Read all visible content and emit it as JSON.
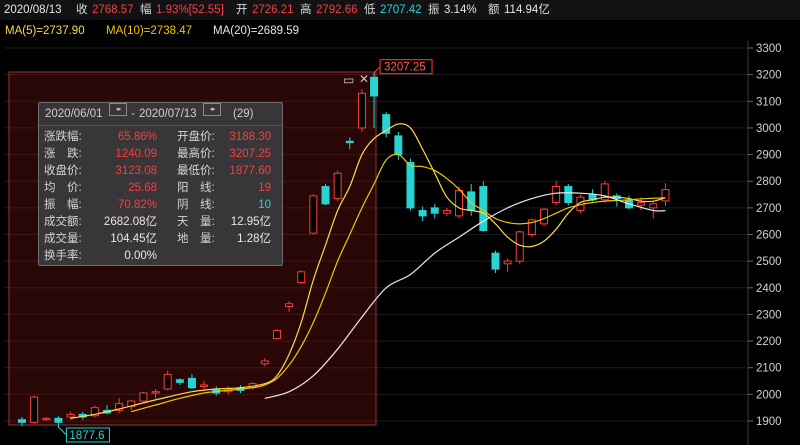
{
  "topbar": {
    "date": "2020/08/13",
    "close_label": "收",
    "close_value": "2768.57",
    "change_label": "幅",
    "change_value": "1.93%[52.55]",
    "open_label": "开",
    "open_value": "2726.21",
    "high_label": "高",
    "high_value": "2792.66",
    "low_label": "低",
    "low_value": "2707.42",
    "amp_label": "振",
    "amp_value": "3.14%",
    "amount_label": "额",
    "amount_value": "114.94亿"
  },
  "ma_bar": {
    "ma5": "MA(5)=2737.90",
    "ma10": "MA(10)=2738.47",
    "ma20": "MA(20)=2689.59"
  },
  "colors": {
    "background": "#000000",
    "up": "#ff3b3b",
    "down": "#27d3d3",
    "ma5": "#ffffff",
    "ma10": "#f5d020",
    "ma20": "#ffffff",
    "selection": "#7a2a2a"
  },
  "chart_data": {
    "type": "candlestick",
    "ylim": [
      1850,
      3330
    ],
    "y_ticks": [
      "1900",
      "2000",
      "2100",
      "2200",
      "2300",
      "2400",
      "2500",
      "2600",
      "2700",
      "2800",
      "2900",
      "3000",
      "3100",
      "3200",
      "3300"
    ],
    "markers": {
      "high_label": "3207.25",
      "low_label": "1877.6"
    },
    "candles": [
      {
        "o": 1905,
        "c": 1895,
        "h": 1915,
        "l": 1880
      },
      {
        "o": 1895,
        "c": 1990,
        "h": 1995,
        "l": 1890
      },
      {
        "o": 1905,
        "c": 1910,
        "h": 1915,
        "l": 1900
      },
      {
        "o": 1910,
        "c": 1895,
        "h": 1918,
        "l": 1877.6
      },
      {
        "o": 1915,
        "c": 1925,
        "h": 1935,
        "l": 1905
      },
      {
        "o": 1925,
        "c": 1915,
        "h": 1935,
        "l": 1905
      },
      {
        "o": 1920,
        "c": 1950,
        "h": 1958,
        "l": 1915
      },
      {
        "o": 1940,
        "c": 1930,
        "h": 1960,
        "l": 1925
      },
      {
        "o": 1940,
        "c": 1965,
        "h": 1985,
        "l": 1930
      },
      {
        "o": 1955,
        "c": 1975,
        "h": 1980,
        "l": 1940
      },
      {
        "o": 1975,
        "c": 2005,
        "h": 2010,
        "l": 1970
      },
      {
        "o": 2005,
        "c": 2010,
        "h": 2020,
        "l": 1985
      },
      {
        "o": 2020,
        "c": 2075,
        "h": 2090,
        "l": 2015
      },
      {
        "o": 2055,
        "c": 2045,
        "h": 2060,
        "l": 2035
      },
      {
        "o": 2060,
        "c": 2025,
        "h": 2075,
        "l": 2020
      },
      {
        "o": 2030,
        "c": 2035,
        "h": 2050,
        "l": 2020
      },
      {
        "o": 2020,
        "c": 2005,
        "h": 2030,
        "l": 1995
      },
      {
        "o": 2010,
        "c": 2020,
        "h": 2030,
        "l": 2000
      },
      {
        "o": 2025,
        "c": 2015,
        "h": 2035,
        "l": 2005
      },
      {
        "o": 2025,
        "c": 2040,
        "h": 2045,
        "l": 2020
      },
      {
        "o": 2115,
        "c": 2125,
        "h": 2135,
        "l": 2105
      },
      {
        "o": 2210,
        "c": 2240,
        "h": 2245,
        "l": 2205
      },
      {
        "o": 2330,
        "c": 2340,
        "h": 2350,
        "l": 2310
      },
      {
        "o": 2420,
        "c": 2460,
        "h": 2465,
        "l": 2415
      },
      {
        "o": 2605,
        "c": 2745,
        "h": 2750,
        "l": 2600
      },
      {
        "o": 2780,
        "c": 2715,
        "h": 2790,
        "l": 2710
      },
      {
        "o": 2735,
        "c": 2830,
        "h": 2840,
        "l": 2725
      },
      {
        "o": 2950,
        "c": 2945,
        "h": 2965,
        "l": 2920
      },
      {
        "o": 3000,
        "c": 3130,
        "h": 3145,
        "l": 2985
      },
      {
        "o": 3190,
        "c": 3120,
        "h": 3207.25,
        "l": 3000
      },
      {
        "o": 3050,
        "c": 2980,
        "h": 3060,
        "l": 2965
      },
      {
        "o": 2970,
        "c": 2900,
        "h": 2985,
        "l": 2880
      },
      {
        "o": 2870,
        "c": 2700,
        "h": 2885,
        "l": 2690
      },
      {
        "o": 2690,
        "c": 2670,
        "h": 2705,
        "l": 2650
      },
      {
        "o": 2700,
        "c": 2680,
        "h": 2715,
        "l": 2660
      },
      {
        "o": 2680,
        "c": 2690,
        "h": 2700,
        "l": 2670
      },
      {
        "o": 2670,
        "c": 2765,
        "h": 2780,
        "l": 2660
      },
      {
        "o": 2760,
        "c": 2690,
        "h": 2790,
        "l": 2670
      },
      {
        "o": 2780,
        "c": 2615,
        "h": 2800,
        "l": 2610
      },
      {
        "o": 2530,
        "c": 2470,
        "h": 2540,
        "l": 2455
      },
      {
        "o": 2490,
        "c": 2500,
        "h": 2510,
        "l": 2460
      },
      {
        "o": 2500,
        "c": 2610,
        "h": 2615,
        "l": 2490
      },
      {
        "o": 2600,
        "c": 2655,
        "h": 2660,
        "l": 2590
      },
      {
        "o": 2640,
        "c": 2695,
        "h": 2700,
        "l": 2630
      },
      {
        "o": 2720,
        "c": 2780,
        "h": 2800,
        "l": 2710
      },
      {
        "o": 2780,
        "c": 2720,
        "h": 2790,
        "l": 2710
      },
      {
        "o": 2690,
        "c": 2740,
        "h": 2750,
        "l": 2680
      },
      {
        "o": 2750,
        "c": 2730,
        "h": 2770,
        "l": 2725
      },
      {
        "o": 2730,
        "c": 2790,
        "h": 2800,
        "l": 2720
      },
      {
        "o": 2745,
        "c": 2735,
        "h": 2755,
        "l": 2705
      },
      {
        "o": 2730,
        "c": 2700,
        "h": 2745,
        "l": 2695
      },
      {
        "o": 2710,
        "c": 2720,
        "h": 2740,
        "l": 2690
      },
      {
        "o": 2700,
        "c": 2715,
        "h": 2725,
        "l": 2660
      },
      {
        "o": 2726.21,
        "c": 2768.57,
        "h": 2792.66,
        "l": 2707.42
      }
    ],
    "ma_lines": [
      {
        "name": "MA5",
        "color": "#ffd84a",
        "points": [
          [
            4,
            1910
          ],
          [
            6,
            1925
          ],
          [
            8,
            1945
          ],
          [
            10,
            1968
          ],
          [
            12,
            1990
          ],
          [
            14,
            2010
          ],
          [
            16,
            2020
          ],
          [
            18,
            2025
          ],
          [
            20,
            2040
          ],
          [
            21,
            2070
          ],
          [
            22,
            2150
          ],
          [
            23,
            2270
          ],
          [
            24,
            2430
          ],
          [
            25,
            2560
          ],
          [
            26,
            2690
          ],
          [
            27,
            2780
          ],
          [
            28,
            2900
          ],
          [
            29,
            2960
          ],
          [
            30,
            2990
          ],
          [
            31,
            3015
          ],
          [
            32,
            3000
          ],
          [
            33,
            2920
          ],
          [
            34,
            2830
          ],
          [
            35,
            2740
          ],
          [
            36,
            2700
          ],
          [
            37,
            2690
          ],
          [
            38,
            2680
          ],
          [
            39,
            2640
          ],
          [
            40,
            2590
          ],
          [
            41,
            2560
          ],
          [
            42,
            2555
          ],
          [
            43,
            2575
          ],
          [
            44,
            2620
          ],
          [
            45,
            2680
          ],
          [
            46,
            2720
          ],
          [
            47,
            2730
          ],
          [
            48,
            2740
          ],
          [
            49,
            2740
          ],
          [
            50,
            2735
          ],
          [
            51,
            2725
          ],
          [
            52,
            2725
          ],
          [
            53,
            2738
          ]
        ]
      },
      {
        "name": "MA10",
        "color": "#f2c400",
        "points": [
          [
            9,
            1935
          ],
          [
            11,
            1960
          ],
          [
            13,
            1985
          ],
          [
            15,
            2005
          ],
          [
            17,
            2015
          ],
          [
            19,
            2025
          ],
          [
            20,
            2035
          ],
          [
            21,
            2060
          ],
          [
            22,
            2110
          ],
          [
            23,
            2180
          ],
          [
            24,
            2270
          ],
          [
            25,
            2380
          ],
          [
            26,
            2500
          ],
          [
            27,
            2600
          ],
          [
            28,
            2700
          ],
          [
            29,
            2790
          ],
          [
            30,
            2880
          ],
          [
            31,
            2900
          ],
          [
            32,
            2860
          ],
          [
            33,
            2855
          ],
          [
            34,
            2840
          ],
          [
            35,
            2810
          ],
          [
            36,
            2770
          ],
          [
            37,
            2720
          ],
          [
            38,
            2690
          ],
          [
            39,
            2660
          ],
          [
            40,
            2645
          ],
          [
            41,
            2640
          ],
          [
            42,
            2645
          ],
          [
            43,
            2660
          ],
          [
            44,
            2680
          ],
          [
            45,
            2700
          ],
          [
            46,
            2712
          ],
          [
            47,
            2720
          ],
          [
            48,
            2725
          ],
          [
            49,
            2728
          ],
          [
            50,
            2730
          ],
          [
            51,
            2734
          ],
          [
            52,
            2736
          ],
          [
            53,
            2738
          ]
        ]
      },
      {
        "name": "MA20",
        "color": "#e8e8e8",
        "points": [
          [
            20,
            1985
          ],
          [
            22,
            2010
          ],
          [
            24,
            2070
          ],
          [
            26,
            2170
          ],
          [
            28,
            2290
          ],
          [
            30,
            2400
          ],
          [
            32,
            2450
          ],
          [
            34,
            2530
          ],
          [
            36,
            2590
          ],
          [
            38,
            2650
          ],
          [
            40,
            2700
          ],
          [
            42,
            2735
          ],
          [
            44,
            2755
          ],
          [
            46,
            2755
          ],
          [
            48,
            2745
          ],
          [
            50,
            2715
          ],
          [
            52,
            2690
          ],
          [
            53,
            2689.59
          ]
        ]
      }
    ]
  },
  "stats_panel": {
    "start_date": "2020/06/01",
    "separator": "-",
    "end_date": "2020/07/13",
    "days": "(29)",
    "rows": [
      {
        "label": "涨跌幅:",
        "value": "65.86%",
        "label2": "开盘价:",
        "value2": "3188.30"
      },
      {
        "label": "涨　跌:",
        "value": "1240.09",
        "label2": "最高价:",
        "value2": "3207.25"
      },
      {
        "label": "收盘价:",
        "value": "3123.08",
        "label2": "最低价:",
        "value2": "1877.60"
      },
      {
        "label": "均　价:",
        "value": "25.68",
        "label2": "阳　线:",
        "value2": "19"
      },
      {
        "label": "振　幅:",
        "value": "70.82%",
        "label2": "阴　线:",
        "value2": "10"
      },
      {
        "label": "成交额:",
        "value": "2682.08亿",
        "label2": "天　量:",
        "value2": "12.95亿"
      },
      {
        "label": "成交量:",
        "value": "104.45亿",
        "label2": "地　量:",
        "value2": "1.28亿"
      },
      {
        "label": "换手率:",
        "value": "0.00%",
        "label2": "",
        "value2": ""
      }
    ]
  }
}
